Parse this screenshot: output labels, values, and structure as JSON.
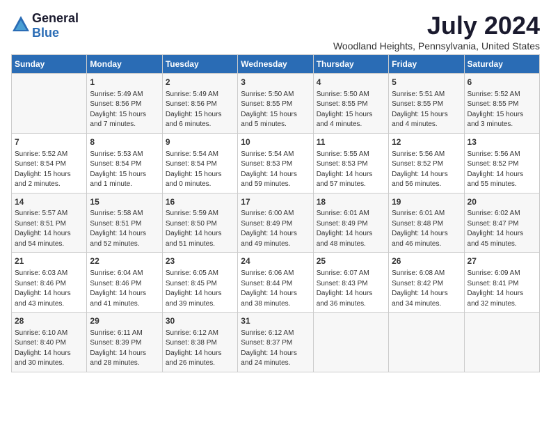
{
  "logo": {
    "general": "General",
    "blue": "Blue"
  },
  "title": "July 2024",
  "subtitle": "Woodland Heights, Pennsylvania, United States",
  "days_of_week": [
    "Sunday",
    "Monday",
    "Tuesday",
    "Wednesday",
    "Thursday",
    "Friday",
    "Saturday"
  ],
  "weeks": [
    [
      {
        "day": "",
        "sunrise": "",
        "sunset": "",
        "daylight": ""
      },
      {
        "day": "1",
        "sunrise": "Sunrise: 5:49 AM",
        "sunset": "Sunset: 8:56 PM",
        "daylight": "Daylight: 15 hours and 7 minutes."
      },
      {
        "day": "2",
        "sunrise": "Sunrise: 5:49 AM",
        "sunset": "Sunset: 8:56 PM",
        "daylight": "Daylight: 15 hours and 6 minutes."
      },
      {
        "day": "3",
        "sunrise": "Sunrise: 5:50 AM",
        "sunset": "Sunset: 8:55 PM",
        "daylight": "Daylight: 15 hours and 5 minutes."
      },
      {
        "day": "4",
        "sunrise": "Sunrise: 5:50 AM",
        "sunset": "Sunset: 8:55 PM",
        "daylight": "Daylight: 15 hours and 4 minutes."
      },
      {
        "day": "5",
        "sunrise": "Sunrise: 5:51 AM",
        "sunset": "Sunset: 8:55 PM",
        "daylight": "Daylight: 15 hours and 4 minutes."
      },
      {
        "day": "6",
        "sunrise": "Sunrise: 5:52 AM",
        "sunset": "Sunset: 8:55 PM",
        "daylight": "Daylight: 15 hours and 3 minutes."
      }
    ],
    [
      {
        "day": "7",
        "sunrise": "Sunrise: 5:52 AM",
        "sunset": "Sunset: 8:54 PM",
        "daylight": "Daylight: 15 hours and 2 minutes."
      },
      {
        "day": "8",
        "sunrise": "Sunrise: 5:53 AM",
        "sunset": "Sunset: 8:54 PM",
        "daylight": "Daylight: 15 hours and 1 minute."
      },
      {
        "day": "9",
        "sunrise": "Sunrise: 5:54 AM",
        "sunset": "Sunset: 8:54 PM",
        "daylight": "Daylight: 15 hours and 0 minutes."
      },
      {
        "day": "10",
        "sunrise": "Sunrise: 5:54 AM",
        "sunset": "Sunset: 8:53 PM",
        "daylight": "Daylight: 14 hours and 59 minutes."
      },
      {
        "day": "11",
        "sunrise": "Sunrise: 5:55 AM",
        "sunset": "Sunset: 8:53 PM",
        "daylight": "Daylight: 14 hours and 57 minutes."
      },
      {
        "day": "12",
        "sunrise": "Sunrise: 5:56 AM",
        "sunset": "Sunset: 8:52 PM",
        "daylight": "Daylight: 14 hours and 56 minutes."
      },
      {
        "day": "13",
        "sunrise": "Sunrise: 5:56 AM",
        "sunset": "Sunset: 8:52 PM",
        "daylight": "Daylight: 14 hours and 55 minutes."
      }
    ],
    [
      {
        "day": "14",
        "sunrise": "Sunrise: 5:57 AM",
        "sunset": "Sunset: 8:51 PM",
        "daylight": "Daylight: 14 hours and 54 minutes."
      },
      {
        "day": "15",
        "sunrise": "Sunrise: 5:58 AM",
        "sunset": "Sunset: 8:51 PM",
        "daylight": "Daylight: 14 hours and 52 minutes."
      },
      {
        "day": "16",
        "sunrise": "Sunrise: 5:59 AM",
        "sunset": "Sunset: 8:50 PM",
        "daylight": "Daylight: 14 hours and 51 minutes."
      },
      {
        "day": "17",
        "sunrise": "Sunrise: 6:00 AM",
        "sunset": "Sunset: 8:49 PM",
        "daylight": "Daylight: 14 hours and 49 minutes."
      },
      {
        "day": "18",
        "sunrise": "Sunrise: 6:01 AM",
        "sunset": "Sunset: 8:49 PM",
        "daylight": "Daylight: 14 hours and 48 minutes."
      },
      {
        "day": "19",
        "sunrise": "Sunrise: 6:01 AM",
        "sunset": "Sunset: 8:48 PM",
        "daylight": "Daylight: 14 hours and 46 minutes."
      },
      {
        "day": "20",
        "sunrise": "Sunrise: 6:02 AM",
        "sunset": "Sunset: 8:47 PM",
        "daylight": "Daylight: 14 hours and 45 minutes."
      }
    ],
    [
      {
        "day": "21",
        "sunrise": "Sunrise: 6:03 AM",
        "sunset": "Sunset: 8:46 PM",
        "daylight": "Daylight: 14 hours and 43 minutes."
      },
      {
        "day": "22",
        "sunrise": "Sunrise: 6:04 AM",
        "sunset": "Sunset: 8:46 PM",
        "daylight": "Daylight: 14 hours and 41 minutes."
      },
      {
        "day": "23",
        "sunrise": "Sunrise: 6:05 AM",
        "sunset": "Sunset: 8:45 PM",
        "daylight": "Daylight: 14 hours and 39 minutes."
      },
      {
        "day": "24",
        "sunrise": "Sunrise: 6:06 AM",
        "sunset": "Sunset: 8:44 PM",
        "daylight": "Daylight: 14 hours and 38 minutes."
      },
      {
        "day": "25",
        "sunrise": "Sunrise: 6:07 AM",
        "sunset": "Sunset: 8:43 PM",
        "daylight": "Daylight: 14 hours and 36 minutes."
      },
      {
        "day": "26",
        "sunrise": "Sunrise: 6:08 AM",
        "sunset": "Sunset: 8:42 PM",
        "daylight": "Daylight: 14 hours and 34 minutes."
      },
      {
        "day": "27",
        "sunrise": "Sunrise: 6:09 AM",
        "sunset": "Sunset: 8:41 PM",
        "daylight": "Daylight: 14 hours and 32 minutes."
      }
    ],
    [
      {
        "day": "28",
        "sunrise": "Sunrise: 6:10 AM",
        "sunset": "Sunset: 8:40 PM",
        "daylight": "Daylight: 14 hours and 30 minutes."
      },
      {
        "day": "29",
        "sunrise": "Sunrise: 6:11 AM",
        "sunset": "Sunset: 8:39 PM",
        "daylight": "Daylight: 14 hours and 28 minutes."
      },
      {
        "day": "30",
        "sunrise": "Sunrise: 6:12 AM",
        "sunset": "Sunset: 8:38 PM",
        "daylight": "Daylight: 14 hours and 26 minutes."
      },
      {
        "day": "31",
        "sunrise": "Sunrise: 6:12 AM",
        "sunset": "Sunset: 8:37 PM",
        "daylight": "Daylight: 14 hours and 24 minutes."
      },
      {
        "day": "",
        "sunrise": "",
        "sunset": "",
        "daylight": ""
      },
      {
        "day": "",
        "sunrise": "",
        "sunset": "",
        "daylight": ""
      },
      {
        "day": "",
        "sunrise": "",
        "sunset": "",
        "daylight": ""
      }
    ]
  ]
}
